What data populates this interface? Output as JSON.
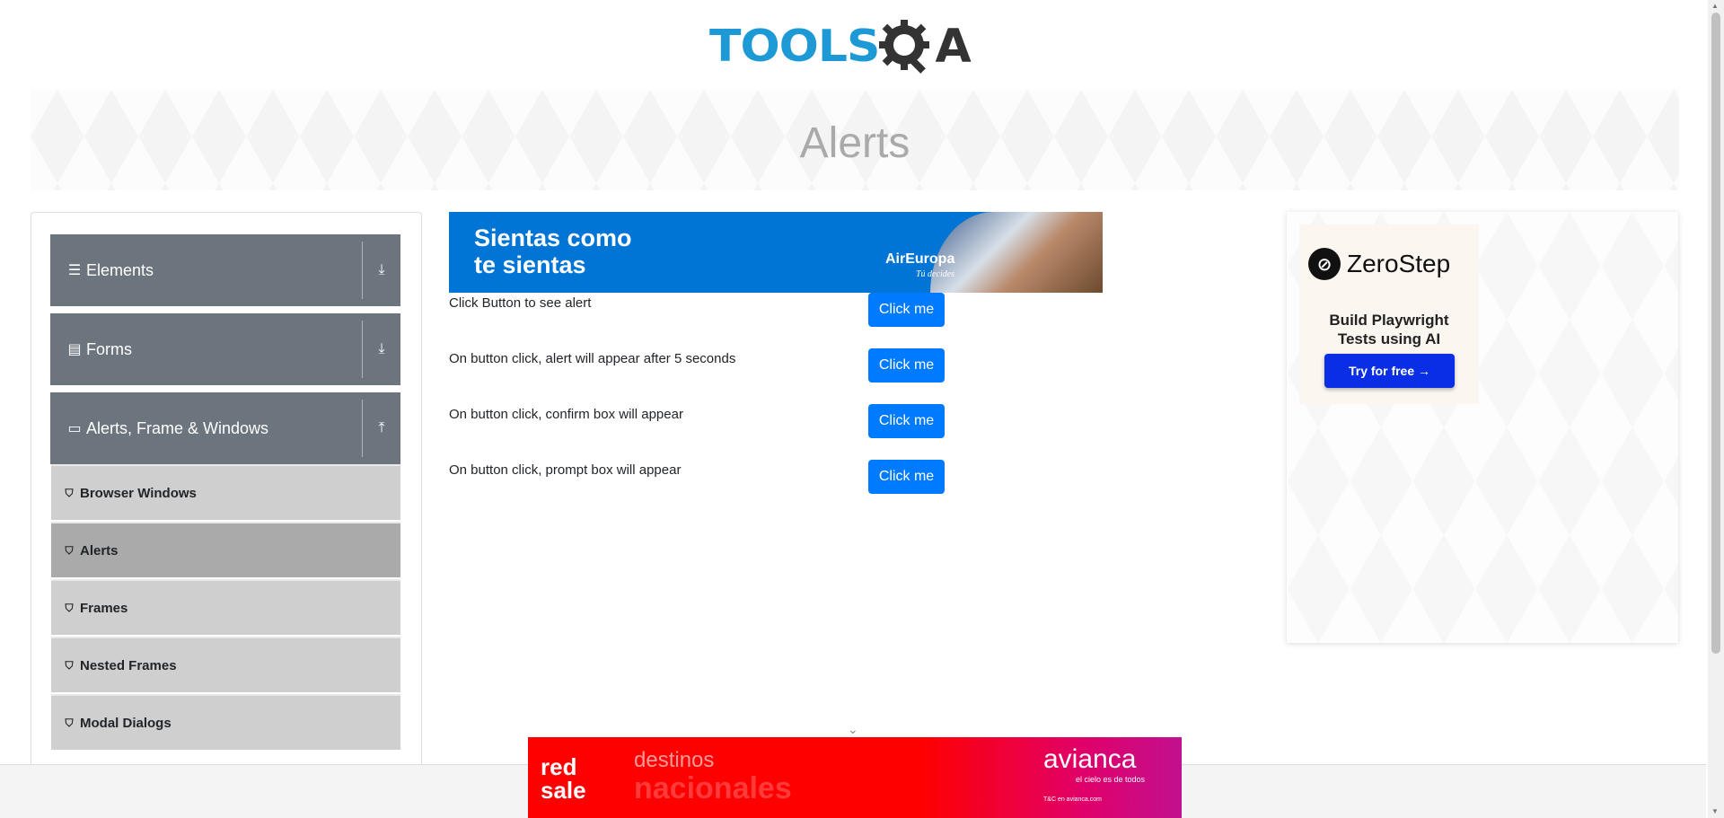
{
  "header": {
    "logo_main": "TOOLS",
    "logo_suffix": "A"
  },
  "banner": {
    "title": "Alerts"
  },
  "sidebar": {
    "groups": [
      {
        "label": "Elements",
        "icon": "hamburger-icon",
        "expanded": false
      },
      {
        "label": "Forms",
        "icon": "document-icon",
        "expanded": false
      },
      {
        "label": "Alerts, Frame & Windows",
        "icon": "window-icon",
        "expanded": true
      }
    ],
    "items": [
      {
        "label": "Browser Windows",
        "active": false
      },
      {
        "label": "Alerts",
        "active": true
      },
      {
        "label": "Frames",
        "active": false
      },
      {
        "label": "Nested Frames",
        "active": false
      },
      {
        "label": "Modal Dialogs",
        "active": false
      }
    ]
  },
  "ad_top": {
    "headline_line1": "Sientas como",
    "headline_line2": "te sientas",
    "brand": "AirEuropa",
    "tagline": "Tú decides"
  },
  "alerts": {
    "rows": [
      {
        "label": "Click Button to see alert",
        "button": "Click me"
      },
      {
        "label": "On button click, alert will appear after 5 seconds",
        "button": "Click me"
      },
      {
        "label": "On button click, confirm box will appear",
        "button": "Click me"
      },
      {
        "label": "On button click, prompt box will appear",
        "button": "Click me"
      }
    ]
  },
  "ad_right": {
    "brand": "ZeroStep",
    "subtitle_line1": "Build Playwright",
    "subtitle_line2": "Tests using AI",
    "cta": "Try for free →"
  },
  "ad_bottom": {
    "red": "red",
    "sale": "sale",
    "destinos": "destinos",
    "nacionales": "nacionales",
    "brand": "avianca",
    "tagline": "el cielo es de todos",
    "legal": "T&C en avianca.com"
  },
  "colors": {
    "primary_button": "#007bff",
    "sidebar_group": "#6c757d",
    "sidebar_item": "#cfcfcf",
    "sidebar_item_active": "#aaaaaa",
    "logo_blue": "#1d9ad6",
    "zerostep_button": "#0a2ee6"
  }
}
